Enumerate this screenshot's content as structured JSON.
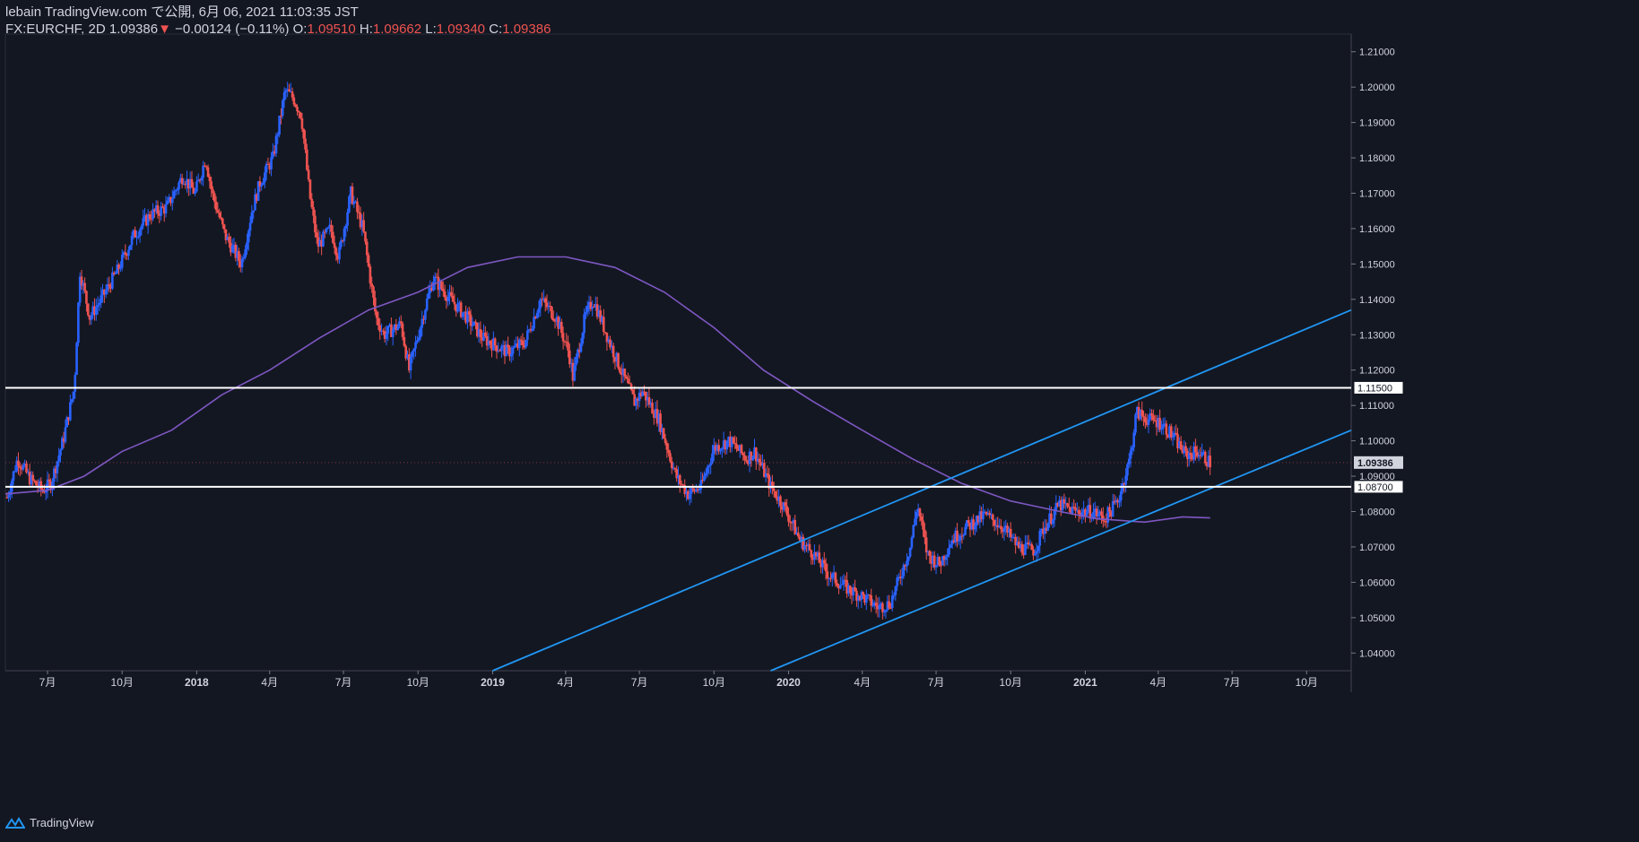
{
  "header": {
    "publisher": "lebain TradingView.com で公開, 6月 06, 2021 11:03:35 JST",
    "symbol": "FX:EURCHF, 2D",
    "last": "1.09386",
    "change_arrow": "▼",
    "change": "−0.00124 (−0.11%)",
    "o_label": "O:",
    "o_value": "1.09510",
    "h_label": "H:",
    "h_value": "1.09662",
    "l_label": "L:",
    "l_value": "1.09340",
    "c_label": "C:",
    "c_value": "1.09386"
  },
  "footer": {
    "brand": "TradingView",
    "logo_icon": "tradingview-logo-icon"
  },
  "colors": {
    "background": "#131722",
    "up": "#2962ff",
    "down": "#ef5350",
    "ma": "#7e57c2",
    "channel": "#2196f3",
    "level": "#ffffff"
  },
  "chart_data": {
    "type": "candlestick",
    "symbol": "FX:EURCHF",
    "interval": "2D",
    "ylim": [
      1.035,
      1.215
    ],
    "x_range": [
      "2017-05-10",
      "2021-11-25"
    ],
    "y_ticks": [
      "1.21000",
      "1.20000",
      "1.19000",
      "1.18000",
      "1.17000",
      "1.16000",
      "1.15000",
      "1.14000",
      "1.13000",
      "1.12000",
      "1.11000",
      "1.10000",
      "1.09000",
      "1.08000",
      "1.07000",
      "1.06000",
      "1.05000",
      "1.04000"
    ],
    "x_ticks": [
      {
        "date": "2017-07-01",
        "label": "7月"
      },
      {
        "date": "2017-10-01",
        "label": "10月"
      },
      {
        "date": "2018-01-01",
        "label": "2018"
      },
      {
        "date": "2018-04-01",
        "label": "4月"
      },
      {
        "date": "2018-07-01",
        "label": "7月"
      },
      {
        "date": "2018-10-01",
        "label": "10月"
      },
      {
        "date": "2019-01-01",
        "label": "2019"
      },
      {
        "date": "2019-04-01",
        "label": "4月"
      },
      {
        "date": "2019-07-01",
        "label": "7月"
      },
      {
        "date": "2019-10-01",
        "label": "10月"
      },
      {
        "date": "2020-01-01",
        "label": "2020"
      },
      {
        "date": "2020-04-01",
        "label": "4月"
      },
      {
        "date": "2020-07-01",
        "label": "7月"
      },
      {
        "date": "2020-10-01",
        "label": "10月"
      },
      {
        "date": "2021-01-01",
        "label": "2021"
      },
      {
        "date": "2021-04-01",
        "label": "4月"
      },
      {
        "date": "2021-07-01",
        "label": "7月"
      },
      {
        "date": "2021-10-01",
        "label": "10月"
      }
    ],
    "price_path": [
      [
        "2017-05-12",
        1.084
      ],
      [
        "2017-05-25",
        1.095
      ],
      [
        "2017-06-10",
        1.089
      ],
      [
        "2017-06-25",
        1.086
      ],
      [
        "2017-07-05",
        1.088
      ],
      [
        "2017-07-20",
        1.1
      ],
      [
        "2017-08-03",
        1.115
      ],
      [
        "2017-08-10",
        1.148
      ],
      [
        "2017-08-22",
        1.135
      ],
      [
        "2017-09-05",
        1.14
      ],
      [
        "2017-09-25",
        1.148
      ],
      [
        "2017-10-15",
        1.158
      ],
      [
        "2017-11-05",
        1.164
      ],
      [
        "2017-11-25",
        1.166
      ],
      [
        "2017-12-15",
        1.175
      ],
      [
        "2017-12-30",
        1.17
      ],
      [
        "2018-01-12",
        1.18
      ],
      [
        "2018-01-20",
        1.17
      ],
      [
        "2018-02-05",
        1.158
      ],
      [
        "2018-02-25",
        1.15
      ],
      [
        "2018-03-10",
        1.165
      ],
      [
        "2018-03-20",
        1.173
      ],
      [
        "2018-04-05",
        1.18
      ],
      [
        "2018-04-20",
        1.199
      ],
      [
        "2018-04-30",
        1.197
      ],
      [
        "2018-05-10",
        1.192
      ],
      [
        "2018-05-20",
        1.17
      ],
      [
        "2018-05-30",
        1.155
      ],
      [
        "2018-06-15",
        1.16
      ],
      [
        "2018-06-25",
        1.152
      ],
      [
        "2018-07-10",
        1.17
      ],
      [
        "2018-07-25",
        1.16
      ],
      [
        "2018-08-10",
        1.135
      ],
      [
        "2018-08-20",
        1.13
      ],
      [
        "2018-09-10",
        1.133
      ],
      [
        "2018-09-20",
        1.12
      ],
      [
        "2018-10-10",
        1.138
      ],
      [
        "2018-10-20",
        1.146
      ],
      [
        "2018-11-10",
        1.14
      ],
      [
        "2018-11-30",
        1.135
      ],
      [
        "2018-12-20",
        1.129
      ],
      [
        "2019-01-20",
        1.125
      ],
      [
        "2019-02-10",
        1.128
      ],
      [
        "2019-03-01",
        1.14
      ],
      [
        "2019-03-20",
        1.135
      ],
      [
        "2019-04-05",
        1.125
      ],
      [
        "2019-04-10",
        1.118
      ],
      [
        "2019-04-25",
        1.135
      ],
      [
        "2019-05-05",
        1.14
      ],
      [
        "2019-05-25",
        1.128
      ],
      [
        "2019-06-10",
        1.119
      ],
      [
        "2019-06-25",
        1.111
      ],
      [
        "2019-07-05",
        1.114
      ],
      [
        "2019-07-25",
        1.106
      ],
      [
        "2019-08-15",
        1.09
      ],
      [
        "2019-08-30",
        1.085
      ],
      [
        "2019-09-15",
        1.087
      ],
      [
        "2019-10-01",
        1.098
      ],
      [
        "2019-10-20",
        1.1
      ],
      [
        "2019-11-10",
        1.095
      ],
      [
        "2019-11-20",
        1.097
      ],
      [
        "2019-12-10",
        1.087
      ],
      [
        "2019-12-25",
        1.082
      ],
      [
        "2020-01-15",
        1.072
      ],
      [
        "2020-02-01",
        1.068
      ],
      [
        "2020-02-20",
        1.062
      ],
      [
        "2020-03-15",
        1.058
      ],
      [
        "2020-04-01",
        1.056
      ],
      [
        "2020-04-20",
        1.053
      ],
      [
        "2020-05-05",
        1.054
      ],
      [
        "2020-05-15",
        1.06
      ],
      [
        "2020-05-30",
        1.07
      ],
      [
        "2020-06-08",
        1.082
      ],
      [
        "2020-06-20",
        1.068
      ],
      [
        "2020-07-05",
        1.065
      ],
      [
        "2020-07-20",
        1.072
      ],
      [
        "2020-08-10",
        1.076
      ],
      [
        "2020-08-30",
        1.079
      ],
      [
        "2020-09-20",
        1.076
      ],
      [
        "2020-10-10",
        1.07
      ],
      [
        "2020-10-30",
        1.069
      ],
      [
        "2020-11-10",
        1.075
      ],
      [
        "2020-11-30",
        1.082
      ],
      [
        "2020-12-20",
        1.08
      ],
      [
        "2021-01-10",
        1.08
      ],
      [
        "2021-01-25",
        1.078
      ],
      [
        "2021-02-10",
        1.083
      ],
      [
        "2021-02-25",
        1.095
      ],
      [
        "2021-03-05",
        1.108
      ],
      [
        "2021-03-20",
        1.106
      ],
      [
        "2021-04-05",
        1.105
      ],
      [
        "2021-04-20",
        1.101
      ],
      [
        "2021-05-05",
        1.096
      ],
      [
        "2021-05-20",
        1.097
      ],
      [
        "2021-06-04",
        1.0938
      ]
    ],
    "moving_average": [
      [
        "2017-05-10",
        1.085
      ],
      [
        "2017-07-01",
        1.086
      ],
      [
        "2017-08-15",
        1.09
      ],
      [
        "2017-10-01",
        1.097
      ],
      [
        "2017-12-01",
        1.103
      ],
      [
        "2018-02-01",
        1.113
      ],
      [
        "2018-04-01",
        1.12
      ],
      [
        "2018-06-01",
        1.129
      ],
      [
        "2018-08-01",
        1.137
      ],
      [
        "2018-10-01",
        1.142
      ],
      [
        "2018-12-01",
        1.149
      ],
      [
        "2019-02-01",
        1.152
      ],
      [
        "2019-04-01",
        1.152
      ],
      [
        "2019-06-01",
        1.149
      ],
      [
        "2019-08-01",
        1.142
      ],
      [
        "2019-10-01",
        1.132
      ],
      [
        "2019-12-01",
        1.12
      ],
      [
        "2020-02-01",
        1.111
      ],
      [
        "2020-04-01",
        1.103
      ],
      [
        "2020-06-01",
        1.095
      ],
      [
        "2020-08-01",
        1.088
      ],
      [
        "2020-10-01",
        1.083
      ],
      [
        "2020-12-01",
        1.08
      ],
      [
        "2021-01-15",
        1.078
      ],
      [
        "2021-03-15",
        1.077
      ],
      [
        "2021-05-01",
        1.0785
      ],
      [
        "2021-06-04",
        1.0782
      ]
    ],
    "horizontal_levels": [
      {
        "price": 1.115,
        "label": "1.11500"
      },
      {
        "price": 1.087,
        "label": "1.08700"
      }
    ],
    "last_price": {
      "price": 1.09386,
      "label": "1.09386"
    },
    "trend_lines": [
      {
        "start": [
          "2019-01-01",
          1.035
        ],
        "end": [
          "2021-11-25",
          1.137
        ]
      },
      {
        "start": [
          "2019-12-10",
          1.035
        ],
        "end": [
          "2021-11-25",
          1.103
        ]
      }
    ]
  }
}
